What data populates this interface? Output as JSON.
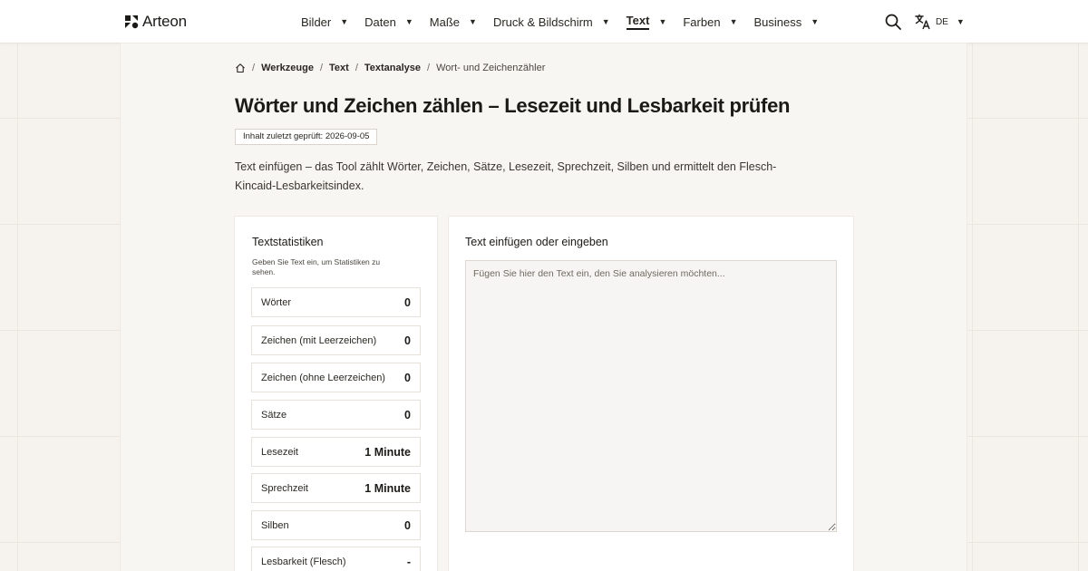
{
  "brand": {
    "name": "Arteon"
  },
  "nav": {
    "items": [
      {
        "label": "Bilder",
        "active": false
      },
      {
        "label": "Daten",
        "active": false
      },
      {
        "label": "Maße",
        "active": false
      },
      {
        "label": "Druck & Bildschirm",
        "active": false
      },
      {
        "label": "Text",
        "active": true
      },
      {
        "label": "Farben",
        "active": false
      },
      {
        "label": "Business",
        "active": false
      }
    ],
    "caret": "▼",
    "search_icon": "search-icon",
    "language": {
      "code": "DE",
      "icon": "translate-icon"
    }
  },
  "breadcrumb": {
    "home_icon": "home-icon",
    "separator": "/",
    "items": [
      "Werkzeuge",
      "Text",
      "Textanalyse"
    ],
    "current": "Wort- und Zeichenzähler"
  },
  "page": {
    "title": "Wörter und Zeichen zählen – Lesezeit und Lesbarkeit prüfen",
    "reviewed": "Inhalt zuletzt geprüft: 2026-09-05",
    "intro": "Text einfügen – das Tool zählt Wörter, Zeichen, Sätze, Lesezeit, Sprechzeit, Silben und ermittelt den Flesch-Kincaid-Lesbarkeitsindex."
  },
  "stats": {
    "title": "Textstatistiken",
    "hint": "Geben Sie Text ein, um Statistiken zu sehen.",
    "rows": [
      {
        "label": "Wörter",
        "value": "0"
      },
      {
        "label": "Zeichen (mit Leerzeichen)",
        "value": "0"
      },
      {
        "label": "Zeichen (ohne Leerzeichen)",
        "value": "0"
      },
      {
        "label": "Sätze",
        "value": "0"
      },
      {
        "label": "Lesezeit",
        "value": "1 Minute"
      },
      {
        "label": "Sprechzeit",
        "value": "1 Minute"
      },
      {
        "label": "Silben",
        "value": "0"
      },
      {
        "label": "Lesbarkeit (Flesch)",
        "value": "-"
      }
    ]
  },
  "editor": {
    "title": "Text einfügen oder eingeben",
    "value": "",
    "placeholder": "Fügen Sie hier den Text ein, den Sie analysieren möchten..."
  },
  "colors": {
    "background": "#f6f3ef",
    "panel": "#f8f6f3",
    "card": "#ffffff",
    "text": "#1c1a17",
    "border": "#e6e1da"
  }
}
